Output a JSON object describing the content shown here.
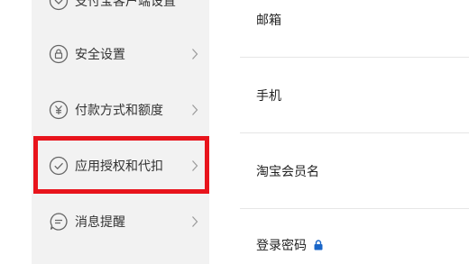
{
  "sidebar": {
    "items": [
      {
        "label": "支付宝客户端设置",
        "icon": "settings-icon"
      },
      {
        "label": "安全设置",
        "icon": "lock-icon"
      },
      {
        "label": "付款方式和额度",
        "icon": "yuan-icon"
      },
      {
        "label": "应用授权和代扣",
        "icon": "check-circle-icon",
        "highlighted": true
      },
      {
        "label": "消息提醒",
        "icon": "message-icon"
      }
    ]
  },
  "main": {
    "rows": [
      {
        "label": "邮箱"
      },
      {
        "label": "手机"
      },
      {
        "label": "淘宝会员名"
      },
      {
        "label": "登录密码",
        "icon": "lock-icon"
      }
    ]
  },
  "colors": {
    "sidebar_bg": "#f2f2f2",
    "highlight": "#e8141c",
    "lock_accent": "#1a66c8"
  }
}
